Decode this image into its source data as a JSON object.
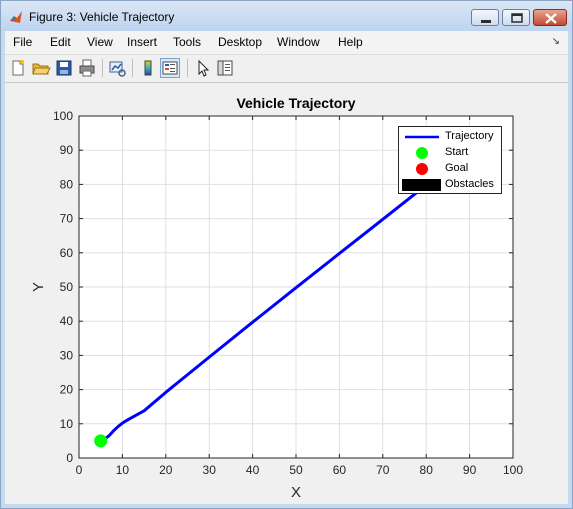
{
  "window": {
    "title": "Figure 3: Vehicle Trajectory"
  },
  "menu": {
    "items": [
      "File",
      "Edit",
      "View",
      "Insert",
      "Tools",
      "Desktop",
      "Window",
      "Help"
    ]
  },
  "toolbar": {
    "icons": [
      "new-figure-icon",
      "open-file-icon",
      "save-icon",
      "print-icon",
      "link-plot-icon",
      "insert-colorbar-icon",
      "insert-legend-icon",
      "edit-plot-icon",
      "property-inspector-icon"
    ]
  },
  "colors": {
    "trajectory": "#0000ff",
    "start": "#00ff00",
    "goal": "#ff0000",
    "obstacles": "#000000"
  },
  "chart_data": {
    "type": "line",
    "title": "Vehicle Trajectory",
    "xlabel": "X",
    "ylabel": "Y",
    "xlim": [
      0,
      100
    ],
    "ylim": [
      0,
      100
    ],
    "xticks": [
      "0",
      "10",
      "20",
      "30",
      "40",
      "50",
      "60",
      "70",
      "80",
      "90",
      "100"
    ],
    "yticks": [
      "0",
      "10",
      "20",
      "30",
      "40",
      "50",
      "60",
      "70",
      "80",
      "90",
      "100"
    ],
    "grid": true,
    "legend_position": "top-right",
    "series": [
      {
        "name": "Trajectory",
        "color": "#0000ff",
        "x": [
          5,
          6,
          7,
          8,
          9,
          10,
          11,
          13,
          15,
          20,
          30,
          40,
          50,
          60,
          70,
          75,
          78,
          80
        ],
        "y": [
          5,
          5.6,
          6.6,
          8,
          9.2,
          10.2,
          11,
          12.4,
          13.8,
          19.2,
          29.5,
          39.7,
          49.8,
          59.8,
          69.8,
          74.8,
          77.8,
          80
        ]
      },
      {
        "name": "Start",
        "color": "#00ff00",
        "x": [
          5
        ],
        "y": [
          5
        ]
      }
    ],
    "legend": [
      {
        "label": "Trajectory",
        "marker": "line",
        "color": "#0000ff"
      },
      {
        "label": "Start",
        "marker": "circle",
        "color": "#00ff00"
      },
      {
        "label": "Goal",
        "marker": "circle",
        "color": "#ff0000"
      },
      {
        "label": "Obstacles",
        "marker": "box",
        "color": "#000000"
      }
    ]
  }
}
